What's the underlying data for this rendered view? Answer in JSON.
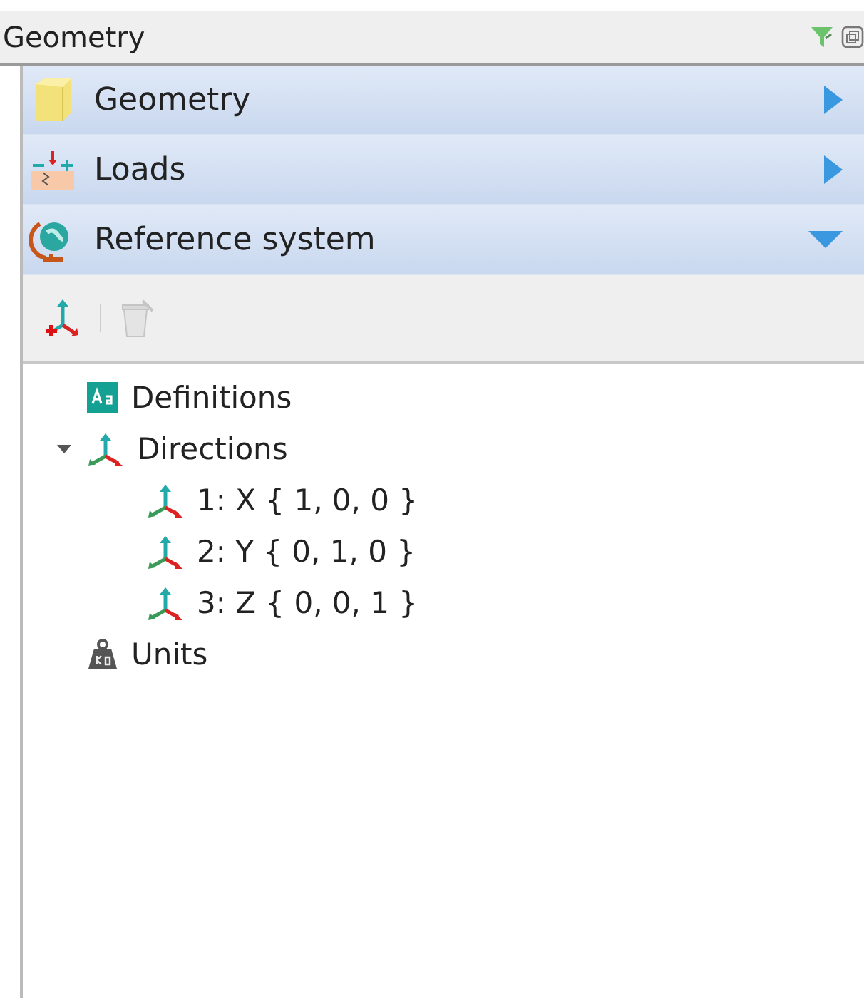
{
  "panel": {
    "title": "Geometry"
  },
  "sections": [
    {
      "kind": "cube",
      "label": "Geometry",
      "expanded": false
    },
    {
      "kind": "loads",
      "label": "Loads",
      "expanded": false
    },
    {
      "kind": "globe",
      "label": "Reference system",
      "expanded": true
    }
  ],
  "toolbar": [
    {
      "kind": "add-axes",
      "disabled": false
    },
    {
      "kind": "delete",
      "disabled": true
    }
  ],
  "tree": [
    {
      "kind": "definitions",
      "label": "Definitions"
    },
    {
      "kind": "axes",
      "label": "Directions",
      "expanded": true,
      "children": [
        {
          "kind": "axes",
          "label": "1: X { 1, 0, 0 }"
        },
        {
          "kind": "axes",
          "label": "2: Y { 0, 1, 0 }"
        },
        {
          "kind": "axes",
          "label": "3: Z { 0, 0, 1 }"
        }
      ]
    },
    {
      "kind": "weight",
      "label": "Units"
    }
  ]
}
